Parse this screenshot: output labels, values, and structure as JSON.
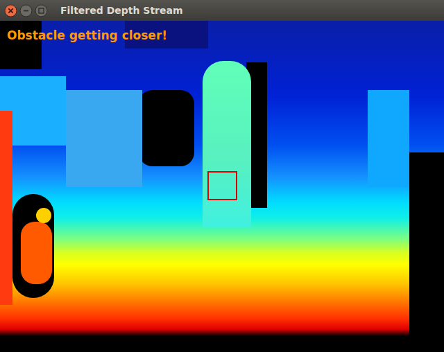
{
  "window": {
    "title": "Filtered Depth Stream"
  },
  "overlay": {
    "warning": "Obstacle getting closer!"
  }
}
